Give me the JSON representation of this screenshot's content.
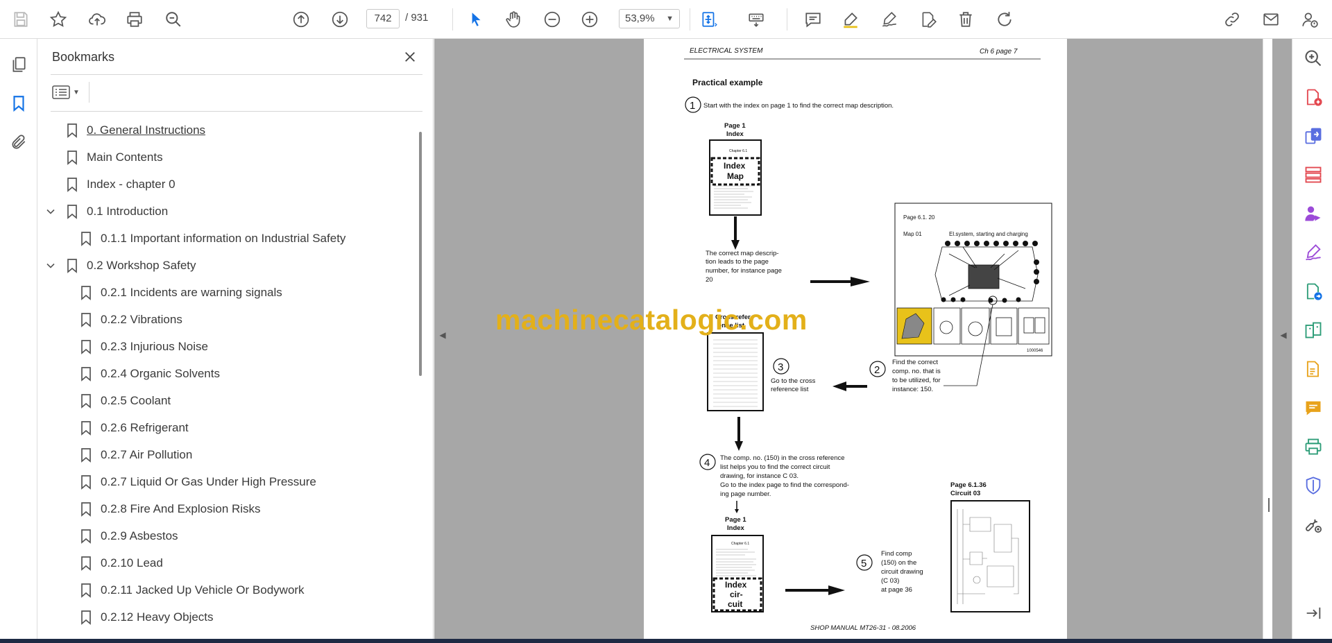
{
  "toolbar": {
    "page_current": "742",
    "page_total": "/ 931",
    "zoom": "53,9%",
    "icons": [
      "save-icon",
      "star-icon",
      "upload-icon",
      "print-icon",
      "zoom-search-icon",
      "prev-page-icon",
      "next-page-icon",
      "select-arrow-icon",
      "hand-icon",
      "zoom-out-icon",
      "zoom-in-icon",
      "fit-page-icon",
      "keyboard-icon",
      "comment-icon",
      "highlight-icon",
      "sign-icon",
      "edit-pdf-icon",
      "delete-icon",
      "rotate-icon",
      "share-link-icon",
      "email-icon",
      "account-icon"
    ]
  },
  "bookmarks": {
    "title": "Bookmarks",
    "items": [
      {
        "label": "0. General Instructions",
        "level": 0,
        "expanded": null,
        "underline": true
      },
      {
        "label": "Main Contents",
        "level": 0,
        "expanded": null
      },
      {
        "label": "Index - chapter 0",
        "level": 0,
        "expanded": null
      },
      {
        "label": "0.1 Introduction",
        "level": 0,
        "expanded": true
      },
      {
        "label": "0.1.1 Important information on Industrial Safety",
        "level": 1,
        "expanded": null
      },
      {
        "label": "0.2 Workshop Safety",
        "level": 0,
        "expanded": true
      },
      {
        "label": "0.2.1 Incidents are warning signals",
        "level": 1,
        "expanded": null
      },
      {
        "label": "0.2.2  Vibrations",
        "level": 1,
        "expanded": null
      },
      {
        "label": "0.2.3 Injurious Noise",
        "level": 1,
        "expanded": null
      },
      {
        "label": "0.2.4 Organic Solvents",
        "level": 1,
        "expanded": null
      },
      {
        "label": "0.2.5 Coolant",
        "level": 1,
        "expanded": null
      },
      {
        "label": "0.2.6 Refrigerant",
        "level": 1,
        "expanded": null
      },
      {
        "label": "0.2.7 Air Pollution",
        "level": 1,
        "expanded": null
      },
      {
        "label": "0.2.7 Liquid Or Gas Under High Pressure",
        "level": 1,
        "expanded": null
      },
      {
        "label": "0.2.8 Fire And Explosion Risks",
        "level": 1,
        "expanded": null
      },
      {
        "label": "0.2.9 Asbestos",
        "level": 1,
        "expanded": null
      },
      {
        "label": "0.2.10 Lead",
        "level": 1,
        "expanded": null
      },
      {
        "label": "0.2.11 Jacked Up Vehicle Or Bodywork",
        "level": 1,
        "expanded": null
      },
      {
        "label": "0.2.12 Heavy Objects",
        "level": 1,
        "expanded": null
      }
    ]
  },
  "document_page": {
    "header_left": "ELECTRICAL SYSTEM",
    "header_right": "Ch 6 page 7",
    "heading": "Practical example",
    "step1_num": "1",
    "step1_text": "Start with the index on page 1 to find the correct map description.",
    "page1_label_a": "Page 1",
    "page1_label_b": "Index",
    "chapter_label": "Chapter 6.1",
    "index_map_a": "Index",
    "index_map_b": "Map",
    "map_desc_lines": [
      "The correct map descrip-",
      "tion leads to the page",
      "number, for instance page",
      "20"
    ],
    "map_page_label": "Page  6.1. 20",
    "map_num": "Map 01",
    "map_title": "El.system, starting and charging",
    "map_ref": "1000546",
    "cross_ref_a": "Cross refer-",
    "cross_ref_b": "ence list",
    "step3_num": "3",
    "step3_lines": [
      "Go to the cross",
      "reference list"
    ],
    "step2_num": "2",
    "step2_lines": [
      "Find the correct",
      "comp. no. that is",
      "to be utilized, for",
      "instance: 150."
    ],
    "step4_num": "4",
    "step4_lines": [
      "The comp. no. (150) in the cross reference",
      "list helps you to find the correct circuit",
      "drawing, for instance C 03.",
      "Go to the index page to find the correspond-",
      "ing page number."
    ],
    "page2_label_a": "Page 1",
    "page2_label_b": "Index",
    "chapter2_label": "Chapter 6.1",
    "index_circ_a": "Index",
    "index_circ_b": "cir-",
    "index_circ_c": "cuit",
    "circuit_page_a": "Page  6.1.36",
    "circuit_page_b": "Circuit 03",
    "step5_num": "5",
    "step5_lines": [
      "Find  comp",
      "(150) on the",
      "circuit drawing",
      "(C 03)",
      "at page 36"
    ],
    "footer": "SHOP MANUAL MT26-31  -  08.2006"
  },
  "watermark": "machinecatalogic.com",
  "colors": {
    "accent": "#1473e6",
    "purple": "#7b61ff",
    "red": "#e34850",
    "green": "#2d9d78",
    "yellow": "#e8a21a",
    "watermark": "#e3b01a"
  }
}
